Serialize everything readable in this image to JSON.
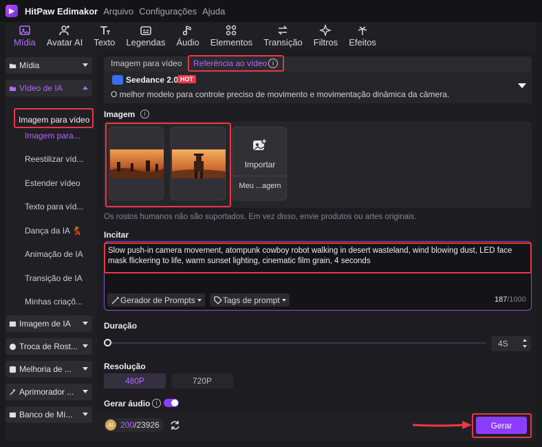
{
  "app": {
    "name": "HitPaw Edimakor",
    "menus": [
      "Arquivo",
      "Configurações",
      "Ajuda"
    ]
  },
  "toolbar": {
    "items": [
      {
        "label": "Mídia",
        "icon": "media-icon"
      },
      {
        "label": "Avatar AI",
        "icon": "avatar-icon"
      },
      {
        "label": "Texto",
        "icon": "text-icon"
      },
      {
        "label": "Legendas",
        "icon": "captions-icon"
      },
      {
        "label": "Áudio",
        "icon": "audio-icon"
      },
      {
        "label": "Elementos",
        "icon": "elements-icon"
      },
      {
        "label": "Transição",
        "icon": "transition-icon"
      },
      {
        "label": "Filtros",
        "icon": "filters-icon"
      },
      {
        "label": "Efeitos",
        "icon": "effects-icon"
      }
    ]
  },
  "sidebar": {
    "sections": {
      "midia": "Mídia",
      "video_ia": "Vídeo de IA",
      "imagem_ia": "Imagem de IA",
      "troca": "Troca de Rost...",
      "melhoria": "Melhoria de ...",
      "aprimorador": "Aprimorador ...",
      "banco": "Banco de Mí..."
    },
    "video_items": [
      "Imagem para vídeo",
      "Imagem para...",
      "Reestilizar víd...",
      "Estender vídeo",
      "Texto para víd...",
      "Dança da IA 💃",
      "Animação de IA",
      "Transição de IA",
      "Minhas criaçõ..."
    ]
  },
  "tabs": {
    "tab1": "Imagem para vídeo",
    "tab2": "Referência ao vídeo"
  },
  "model": {
    "name": "Seedance 2.0",
    "badge": "HOT",
    "desc": "O melhor modelo para controle preciso de movimento e movimentação dinâmica da câmera."
  },
  "image": {
    "heading": "Imagem",
    "import_label": "Importar",
    "my_label": "Meu ...agem",
    "note": "Os rostos humanos não são suportados. Em vez disso, envie produtos ou artes originais."
  },
  "prompt": {
    "heading": "Incitar",
    "text": "Slow push-in camera movement, atompunk cowboy robot walking in desert wasteland, wind blowing dust, LED face mask flickering to life, warm sunset lighting, cinematic film grain, 4 seconds",
    "gen_btn": "Gerador de Prompts",
    "tags_btn": "Tags de prompt",
    "count": "187",
    "max": "/1000"
  },
  "duration": {
    "heading": "Duração",
    "value": "4S"
  },
  "resolution": {
    "heading": "Resolução",
    "options": [
      "480P",
      "720P"
    ],
    "selected": "480P"
  },
  "audio": {
    "heading": "Gerar áudio",
    "enabled": true
  },
  "credits": {
    "used": "200",
    "total": "/23926"
  },
  "generate_label": "Gerar",
  "colors": {
    "accent": "#8a3dff",
    "highlight": "#e8384a"
  }
}
